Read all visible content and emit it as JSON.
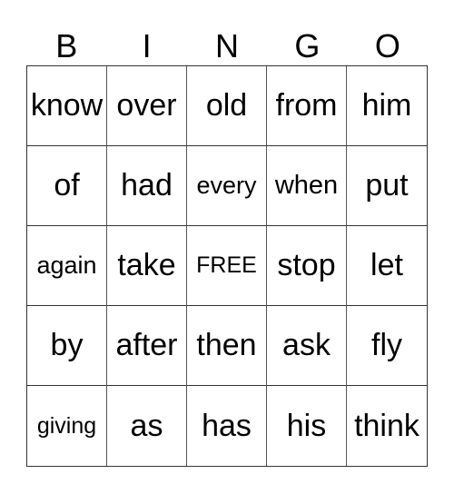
{
  "header": [
    "B",
    "I",
    "N",
    "G",
    "O"
  ],
  "cells": [
    [
      "know",
      "over",
      "old",
      "from",
      "him"
    ],
    [
      "of",
      "had",
      "every",
      "when",
      "put"
    ],
    [
      "again",
      "take",
      "FREE",
      "stop",
      "let"
    ],
    [
      "by",
      "after",
      "then",
      "ask",
      "fly"
    ],
    [
      "giving",
      "as",
      "has",
      "his",
      "think"
    ]
  ]
}
